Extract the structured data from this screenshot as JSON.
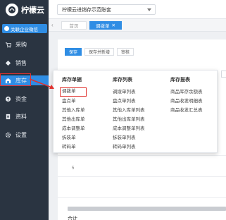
{
  "app": {
    "logo_text": "柠檬云",
    "link_button": "关联企业微信"
  },
  "sidebar": {
    "items": [
      {
        "label": "采购",
        "icon": "cart-icon"
      },
      {
        "label": "销售",
        "icon": "tag-icon"
      },
      {
        "label": "库存",
        "icon": "warehouse-icon",
        "active": true
      },
      {
        "label": "资金",
        "icon": "coin-icon"
      },
      {
        "label": "资料",
        "icon": "document-icon"
      },
      {
        "label": "设置",
        "icon": "gear-icon"
      }
    ]
  },
  "header": {
    "account_select": "柠檬云进销存示范账套"
  },
  "tabs": {
    "home": "首页",
    "active": "调拨单"
  },
  "toolbar": {
    "save": "保存",
    "save_add": "保存并新增",
    "audit": "审核"
  },
  "menu": {
    "columns": [
      {
        "title": "库存单据",
        "items": [
          "调拨单",
          "盘点单",
          "其他入库单",
          "其他出库单",
          "成本调整单",
          "拆装单",
          "转码单"
        ]
      },
      {
        "title": "库存列表",
        "items": [
          "调拨单列表",
          "盘点单列表",
          "其他入库单列表",
          "其他出库单列表",
          "成本调整单列表",
          "拆装单列表",
          "转码单列表"
        ]
      },
      {
        "title": "库存报表",
        "items": [
          "商品库存余额表",
          "商品收发明细表",
          "商品收发汇总表"
        ]
      }
    ],
    "selected": "调拨单"
  },
  "table": {
    "row_number": "5",
    "total_label": "合计"
  },
  "colors": {
    "sidebar_bg": "#2a3441",
    "accent": "#2f8de4",
    "highlight": "#e0322e"
  }
}
